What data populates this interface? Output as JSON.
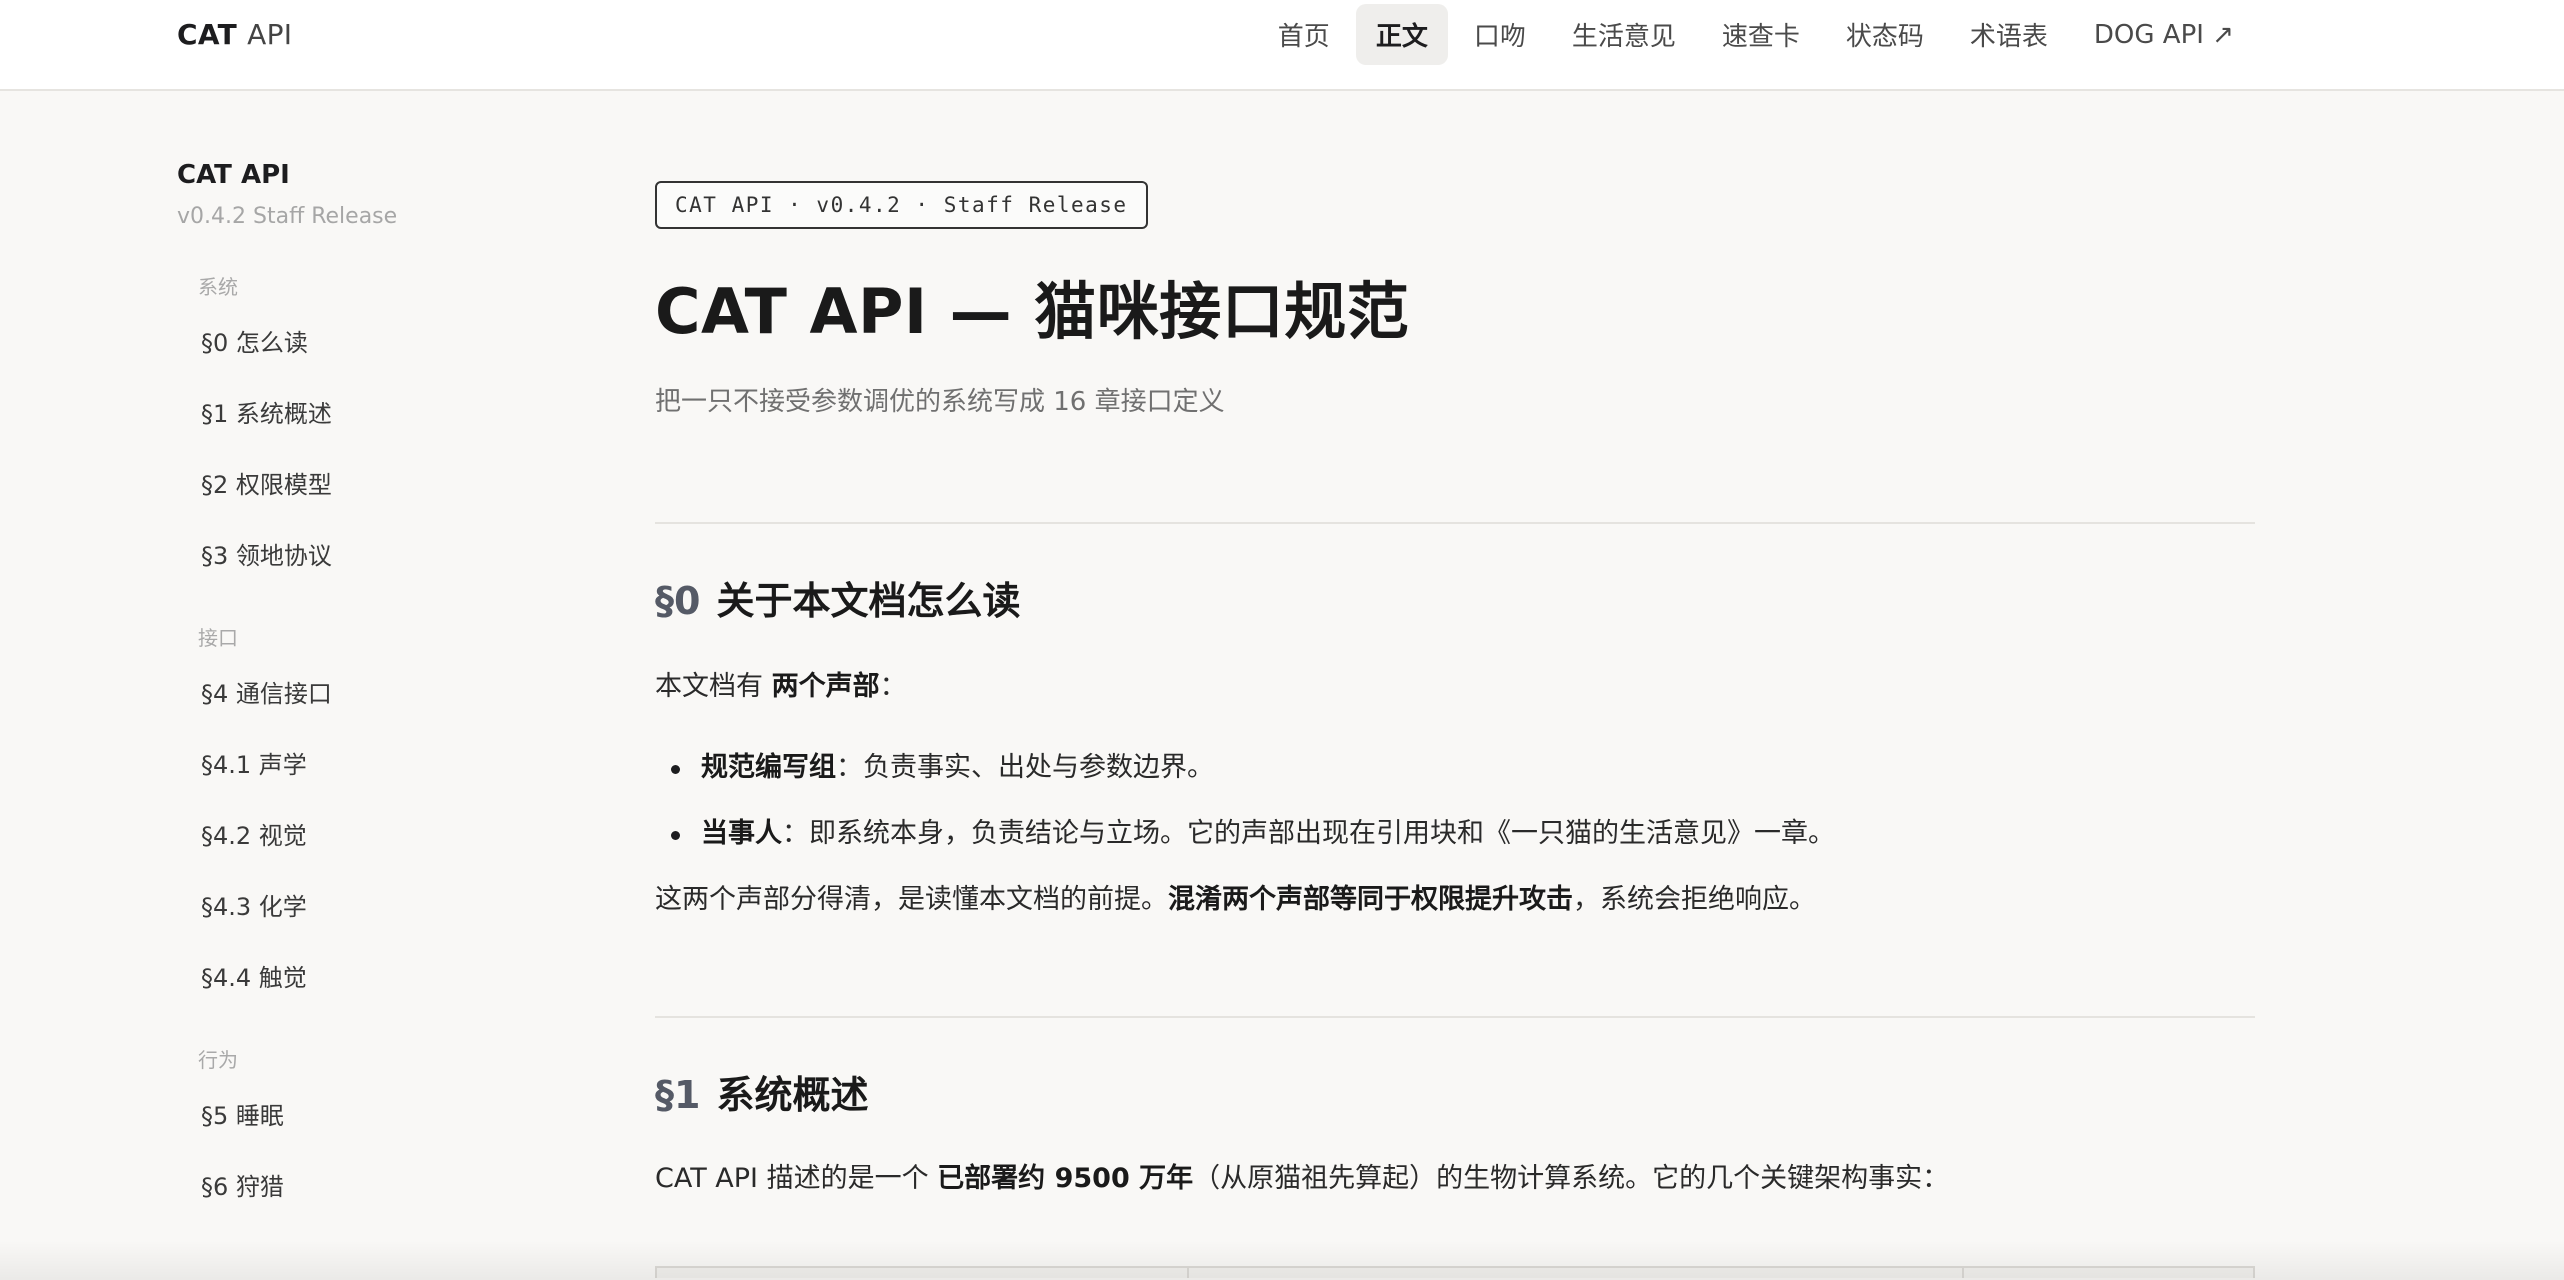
{
  "header": {
    "brand_cat": "CAT",
    "brand_api": "API",
    "nav": [
      {
        "label": "首页",
        "active": false
      },
      {
        "label": "正文",
        "active": true
      },
      {
        "label": "口吻",
        "active": false
      },
      {
        "label": "生活意见",
        "active": false
      },
      {
        "label": "速查卡",
        "active": false
      },
      {
        "label": "状态码",
        "active": false
      },
      {
        "label": "术语表",
        "active": false
      },
      {
        "label": "DOG API ↗",
        "active": false
      }
    ]
  },
  "sidebar": {
    "title": "CAT API",
    "subtitle": "v0.4.2 Staff Release",
    "groups": [
      {
        "label": "系统",
        "items": [
          "§0 怎么读",
          "§1 系统概述",
          "§2 权限模型",
          "§3 领地协议"
        ]
      },
      {
        "label": "接口",
        "items": [
          "§4 通信接口",
          "§4.1 声学",
          "§4.2 视觉",
          "§4.3 化学",
          "§4.4 触觉"
        ]
      },
      {
        "label": "行为",
        "items": [
          "§5 睡眠",
          "§6 狩猎"
        ]
      }
    ]
  },
  "main": {
    "badge": "CAT API · v0.4.2 · Staff Release",
    "title": "CAT API — 猫咪接口规范",
    "subtitle": "把一只不接受参数调优的系统写成 16 章接口定义",
    "sec0": {
      "num": "§0",
      "title": "关于本文档怎么读",
      "intro_pre": "本文档有 ",
      "intro_bold": "两个声部",
      "intro_post": "：",
      "bullets": [
        {
          "bold": "规范编写组",
          "text": "：负责事实、出处与参数边界。"
        },
        {
          "bold": "当事人",
          "text": "：即系统本身，负责结论与立场。它的声部出现在引用块和《一只猫的生活意见》一章。"
        }
      ],
      "closing_pre": "这两个声部分得清，是读懂本文档的前提。",
      "closing_bold": "混淆两个声部等同于权限提升攻击",
      "closing_post": "，系统会拒绝响应。"
    },
    "sec1": {
      "num": "§1",
      "title": "系统概述",
      "para_pre": "CAT API 描述的是一个 ",
      "para_bold": "已部署约 9500 万年",
      "para_post": "（从原猫祖先算起）的生物计算系统。它的几个关键架构事实："
    }
  }
}
